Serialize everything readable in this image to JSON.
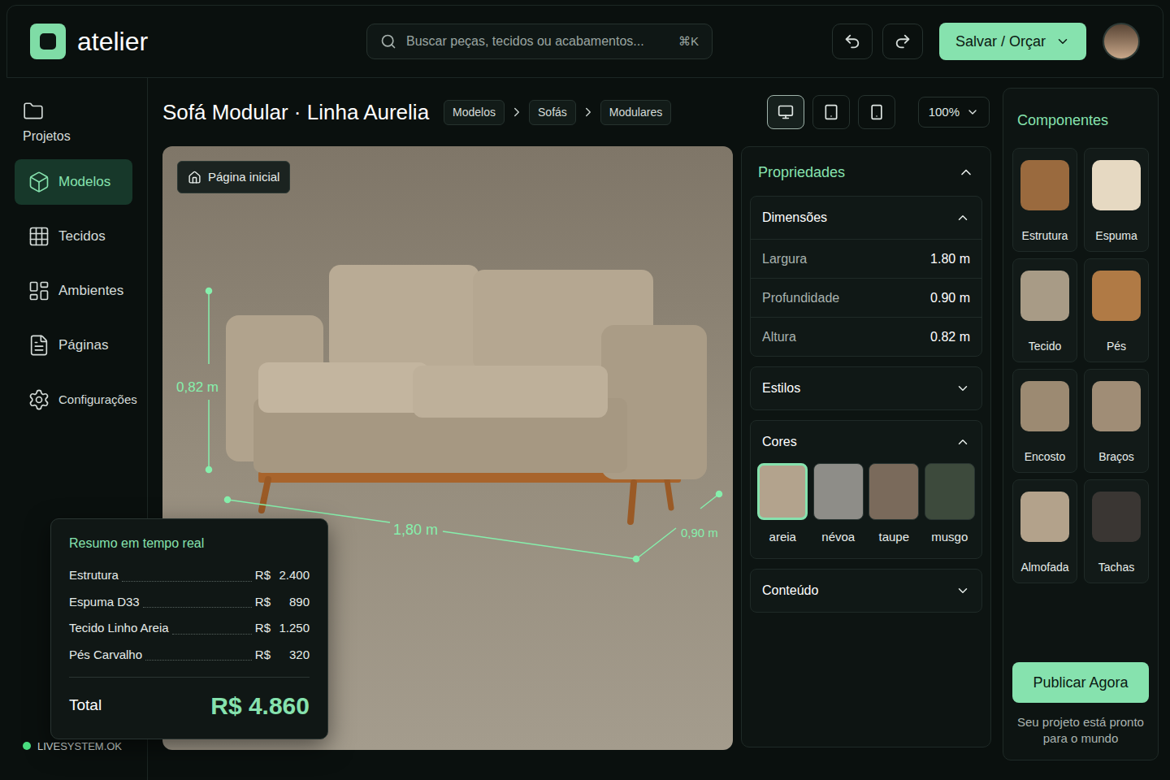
{
  "app": {
    "logo": "atelier"
  },
  "search": {
    "placeholder": "Buscar peças, tecidos ou acabamentos...",
    "shortcut": "⌘K"
  },
  "toolbar": {
    "save_button": "Salvar / Orçar"
  },
  "sidebar": {
    "items": [
      {
        "label": "Projetos",
        "selected": false,
        "kind": "stacked"
      },
      {
        "label": "Modelos",
        "selected": true,
        "kind": "row"
      },
      {
        "label": "Tecidos",
        "selected": false,
        "kind": "row"
      },
      {
        "label": "Ambientes",
        "selected": false,
        "kind": "row"
      },
      {
        "label": "Páginas",
        "selected": false,
        "kind": "row"
      },
      {
        "label": "Configurações",
        "selected": false,
        "kind": "row"
      }
    ],
    "status": {
      "label": "LIVESYSTEM.OK",
      "color": "#4ade80"
    }
  },
  "header": {
    "title": "Sofá Modular · Linha Aurelia",
    "breadcrumbs": [
      "Modelos",
      "Sofás",
      "Modulares"
    ],
    "devices": [
      {
        "device": "desktop",
        "selected": true
      },
      {
        "device": "tablet",
        "selected": false
      },
      {
        "device": "mobile",
        "selected": false
      }
    ],
    "zoom": "100%"
  },
  "canvas": {
    "home_button": "Página inicial",
    "dimensions": {
      "height": "0,82 m",
      "width": "1,80 m",
      "depth": "0,90 m"
    }
  },
  "summary": {
    "title": "Resumo em tempo real",
    "items": [
      {
        "label": "Estrutura",
        "currency": "R$",
        "value": "2.400"
      },
      {
        "label": "Espuma D33",
        "currency": "R$",
        "value": "890"
      },
      {
        "label": "Tecido Linho Areia",
        "currency": "R$",
        "value": "1.250"
      },
      {
        "label": "Pés Carvalho",
        "currency": "R$",
        "value": "320"
      }
    ],
    "total_label": "Total",
    "total": "R$ 4.860"
  },
  "properties": {
    "title": "Propriedades",
    "expanded": true,
    "sections": [
      {
        "title": "Dimensões",
        "expanded": true,
        "kind": "rows",
        "rows": [
          {
            "label": "Largura",
            "value": "1.80 m"
          },
          {
            "label": "Profundidade",
            "value": "0.90 m"
          },
          {
            "label": "Altura",
            "value": "0.82 m"
          }
        ]
      },
      {
        "title": "Estilos",
        "expanded": false,
        "kind": "empty"
      },
      {
        "title": "Cores",
        "expanded": true,
        "kind": "swatches",
        "swatches": [
          {
            "label": "areia",
            "color": "#b3a38d",
            "selected": true
          },
          {
            "label": "névoa",
            "color": "#8e8d88",
            "selected": false
          },
          {
            "label": "taupe",
            "color": "#7a6a5b",
            "selected": false
          },
          {
            "label": "musgo",
            "color": "#3d4a3c",
            "selected": false
          }
        ]
      },
      {
        "title": "Conteúdo",
        "expanded": false,
        "kind": "empty"
      }
    ]
  },
  "components": {
    "title": "Componentes",
    "items": [
      "Estrutura",
      "Espuma",
      "Tecido",
      "Pés",
      "Encosto",
      "Braços",
      "Almofada",
      "Tachas"
    ]
  },
  "publish": {
    "button": "Publicar Agora",
    "note": "Seu projeto está pronto para o mundo"
  }
}
